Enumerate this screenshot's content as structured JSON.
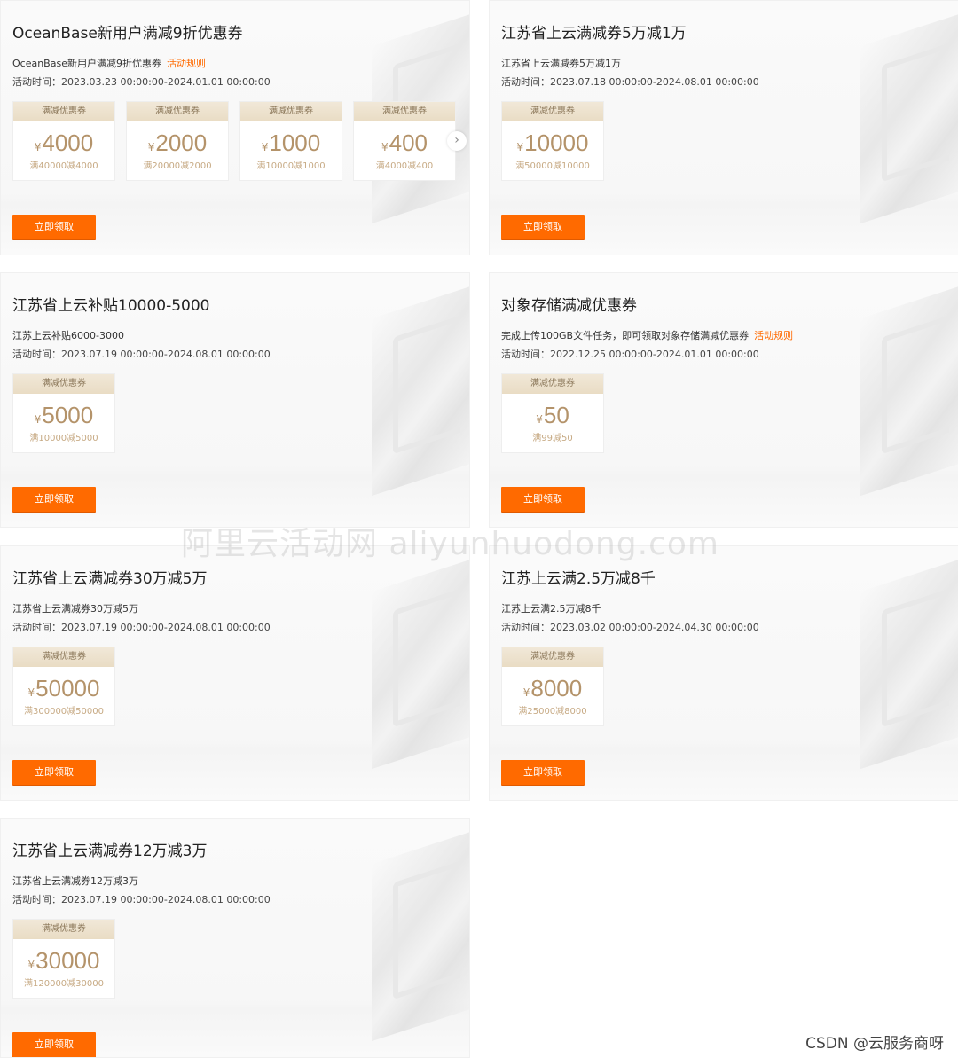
{
  "common": {
    "coupon_header": "满减优惠券",
    "claim_label": "立即领取",
    "currency_symbol": "¥",
    "rules_link": "活动规则"
  },
  "cards": [
    {
      "title": "OceanBase新用户满减9折优惠券",
      "desc": "OceanBase新用户满减9折优惠券",
      "has_rules_link": true,
      "period": "活动时间：2023.03.23 00:00:00-2024.01.01 00:00:00",
      "coupons": [
        {
          "amount": "4000",
          "condition": "满40000减4000"
        },
        {
          "amount": "2000",
          "condition": "满20000减2000"
        },
        {
          "amount": "1000",
          "condition": "满10000减1000"
        },
        {
          "amount": "400",
          "condition": "满4000减400"
        }
      ],
      "has_next_arrow": true
    },
    {
      "title": "江苏省上云满减券5万减1万",
      "desc": "江苏省上云满减券5万减1万",
      "has_rules_link": false,
      "period": "活动时间：2023.07.18 00:00:00-2024.08.01 00:00:00",
      "coupons": [
        {
          "amount": "10000",
          "condition": "满50000减10000"
        }
      ],
      "has_next_arrow": false
    },
    {
      "title": "江苏省上云补贴10000-5000",
      "desc": "江苏上云补贴6000-3000",
      "has_rules_link": false,
      "period": "活动时间：2023.07.19 00:00:00-2024.08.01 00:00:00",
      "coupons": [
        {
          "amount": "5000",
          "condition": "满10000减5000"
        }
      ],
      "has_next_arrow": false
    },
    {
      "title": "对象存储满减优惠券",
      "desc": "完成上传100GB文件任务，即可领取对象存储满减优惠券",
      "has_rules_link": true,
      "period": "活动时间：2022.12.25 00:00:00-2024.01.01 00:00:00",
      "coupons": [
        {
          "amount": "50",
          "condition": "满99减50"
        }
      ],
      "has_next_arrow": false
    },
    {
      "title": "江苏省上云满减券30万减5万",
      "desc": "江苏省上云满减券30万减5万",
      "has_rules_link": false,
      "period": "活动时间：2023.07.19 00:00:00-2024.08.01 00:00:00",
      "coupons": [
        {
          "amount": "50000",
          "condition": "满300000减50000"
        }
      ],
      "has_next_arrow": false
    },
    {
      "title": "江苏上云满2.5万减8千",
      "desc": "江苏上云满2.5万减8千",
      "has_rules_link": false,
      "period": "活动时间：2023.03.02 00:00:00-2024.04.30 00:00:00",
      "coupons": [
        {
          "amount": "8000",
          "condition": "满25000减8000"
        }
      ],
      "has_next_arrow": false
    },
    {
      "title": "江苏省上云满减券12万减3万",
      "desc": "江苏省上云满减券12万减3万",
      "has_rules_link": false,
      "period": "活动时间：2023.07.19 00:00:00-2024.08.01 00:00:00",
      "coupons": [
        {
          "amount": "30000",
          "condition": "满120000减30000"
        }
      ],
      "has_next_arrow": false
    }
  ],
  "watermark": "阿里云活动网 aliyunhuodong.com",
  "credit": "CSDN @云服务商呀"
}
